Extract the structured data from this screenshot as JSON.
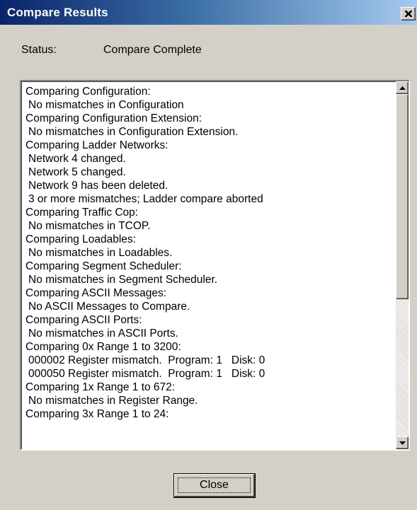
{
  "window": {
    "title": "Compare Results",
    "close_icon": "close-x-icon"
  },
  "status": {
    "label": "Status:",
    "value": "Compare Complete"
  },
  "results": {
    "lines": [
      {
        "text": "Comparing Configuration:",
        "indent": false
      },
      {
        "text": "No mismatches in Configuration",
        "indent": true
      },
      {
        "text": "Comparing Configuration Extension:",
        "indent": false
      },
      {
        "text": "No mismatches in Configuration Extension.",
        "indent": true
      },
      {
        "text": "Comparing Ladder Networks:",
        "indent": false
      },
      {
        "text": "Network 4 changed.",
        "indent": true
      },
      {
        "text": "Network 5 changed.",
        "indent": true
      },
      {
        "text": "Network 9 has been deleted.",
        "indent": true
      },
      {
        "text": "3 or more mismatches; Ladder compare aborted",
        "indent": true
      },
      {
        "text": "Comparing Traffic Cop:",
        "indent": false
      },
      {
        "text": "No mismatches in TCOP.",
        "indent": true
      },
      {
        "text": "Comparing Loadables:",
        "indent": false
      },
      {
        "text": "No mismatches in Loadables.",
        "indent": true
      },
      {
        "text": "Comparing Segment Scheduler:",
        "indent": false
      },
      {
        "text": "No mismatches in Segment Scheduler.",
        "indent": true
      },
      {
        "text": "Comparing ASCII Messages:",
        "indent": false
      },
      {
        "text": "No ASCII Messages to Compare.",
        "indent": true
      },
      {
        "text": "Comparing ASCII Ports:",
        "indent": false
      },
      {
        "text": "No mismatches in ASCII Ports.",
        "indent": true
      },
      {
        "text": "Comparing 0x Range 1 to 3200:",
        "indent": false
      },
      {
        "text": "000002 Register mismatch.  Program: 1   Disk: 0",
        "indent": true
      },
      {
        "text": "000050 Register mismatch.  Program: 1   Disk: 0",
        "indent": true
      },
      {
        "text": "Comparing 1x Range 1 to 672:",
        "indent": false
      },
      {
        "text": "No mismatches in Register Range.",
        "indent": true
      },
      {
        "text": "Comparing 3x Range 1 to 24:",
        "indent": false
      }
    ]
  },
  "scrollbar": {
    "up_icon": "scroll-up-arrow-icon",
    "down_icon": "scroll-down-arrow-icon"
  },
  "buttons": {
    "close_label": "Close"
  },
  "colors": {
    "titlebar_start": "#0a246a",
    "titlebar_end": "#a6caf0",
    "face": "#d4d0c8"
  }
}
